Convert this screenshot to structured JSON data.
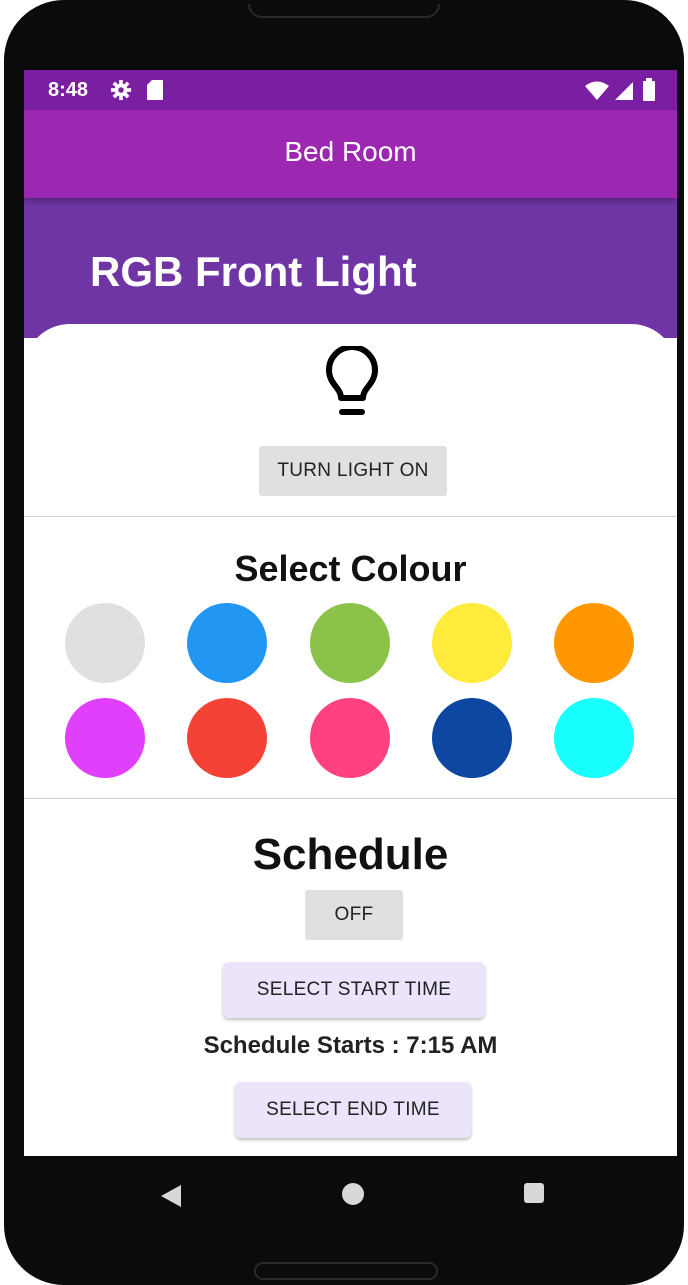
{
  "status_bar": {
    "time": "8:48",
    "icons": [
      "gear-icon",
      "sd-card-icon",
      "wifi-icon",
      "signal-icon",
      "battery-icon"
    ]
  },
  "app_bar": {
    "title": "Bed Room"
  },
  "device": {
    "name": "RGB Front Light",
    "icon": "lightbulb-icon",
    "toggle_label": "TURN LIGHT ON"
  },
  "colour_section": {
    "title": "Select Colour",
    "colours": [
      "#e0e0e0",
      "#2196f3",
      "#8bc34a",
      "#ffeb3b",
      "#ff9800",
      "#e040fb",
      "#f44336",
      "#ff4081",
      "#0d47a1",
      "#18ffff"
    ]
  },
  "schedule_section": {
    "title": "Schedule",
    "toggle_label": "OFF",
    "start_button_label": "SELECT START TIME",
    "start_text": "Schedule Starts : 7:15 AM",
    "end_button_label": "SELECT END TIME"
  },
  "theme": {
    "status_bar": "#7b1fa2",
    "app_bar": "#9c27b0",
    "header": "#6f35a5"
  },
  "nav_bar": {
    "icons": [
      "back-icon",
      "home-icon",
      "recents-icon"
    ]
  }
}
